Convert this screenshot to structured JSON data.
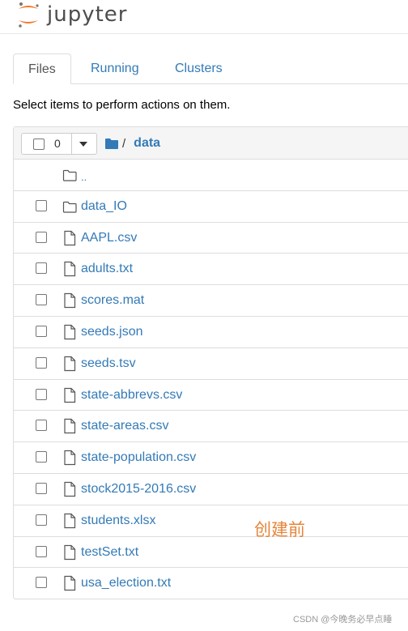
{
  "app": {
    "logo_text": "jupyter"
  },
  "tabs": [
    {
      "label": "Files",
      "active": true
    },
    {
      "label": "Running",
      "active": false
    },
    {
      "label": "Clusters",
      "active": false
    }
  ],
  "instructions": "Select items to perform actions on them.",
  "toolbar": {
    "selected_count": "0"
  },
  "breadcrumb": {
    "separator": "/",
    "current": "data"
  },
  "files": [
    {
      "name": "..",
      "type": "folder",
      "has_checkbox": false
    },
    {
      "name": "data_IO",
      "type": "folder",
      "has_checkbox": true
    },
    {
      "name": "AAPL.csv",
      "type": "file",
      "has_checkbox": true
    },
    {
      "name": "adults.txt",
      "type": "file",
      "has_checkbox": true
    },
    {
      "name": "scores.mat",
      "type": "file",
      "has_checkbox": true
    },
    {
      "name": "seeds.json",
      "type": "file",
      "has_checkbox": true
    },
    {
      "name": "seeds.tsv",
      "type": "file",
      "has_checkbox": true
    },
    {
      "name": "state-abbrevs.csv",
      "type": "file",
      "has_checkbox": true
    },
    {
      "name": "state-areas.csv",
      "type": "file",
      "has_checkbox": true
    },
    {
      "name": "state-population.csv",
      "type": "file",
      "has_checkbox": true
    },
    {
      "name": "stock2015-2016.csv",
      "type": "file",
      "has_checkbox": true
    },
    {
      "name": "students.xlsx",
      "type": "file",
      "has_checkbox": true
    },
    {
      "name": "testSet.txt",
      "type": "file",
      "has_checkbox": true
    },
    {
      "name": "usa_election.txt",
      "type": "file",
      "has_checkbox": true
    }
  ],
  "annotation": "创建前",
  "watermark": "CSDN @今晚务必早点睡",
  "colors": {
    "link": "#337ab7",
    "logo_orange": "#f37726",
    "annotation": "#e6853a"
  }
}
